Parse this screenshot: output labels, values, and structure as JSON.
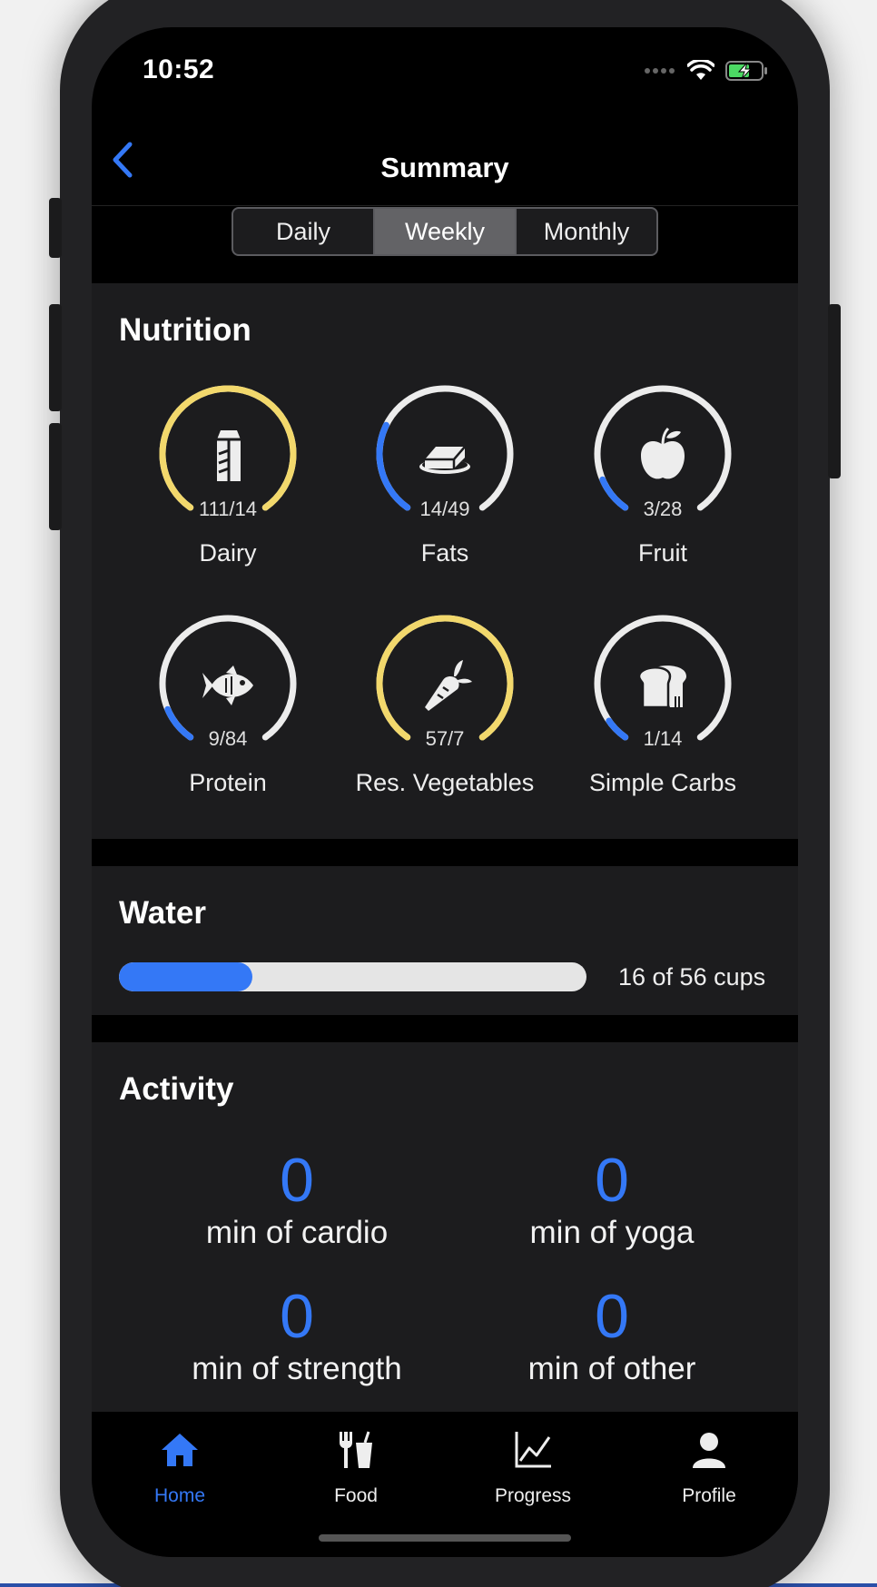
{
  "status_bar": {
    "time": "10:52"
  },
  "nav": {
    "title": "Summary"
  },
  "segments": [
    {
      "label": "Daily",
      "active": false
    },
    {
      "label": "Weekly",
      "active": true
    },
    {
      "label": "Monthly",
      "active": false
    }
  ],
  "nutrition": {
    "title": "Nutrition",
    "items": [
      {
        "label": "Dairy",
        "count": "111/14",
        "progress": 1.0,
        "color": "#f2d86c",
        "icon": "milk-carton-icon"
      },
      {
        "label": "Fats",
        "count": "14/49",
        "progress": 0.28,
        "color": "#3478f6",
        "icon": "butter-icon"
      },
      {
        "label": "Fruit",
        "count": "3/28",
        "progress": 0.11,
        "color": "#3478f6",
        "icon": "apple-icon"
      },
      {
        "label": "Protein",
        "count": "9/84",
        "progress": 0.11,
        "color": "#3478f6",
        "icon": "fish-icon"
      },
      {
        "label": "Res. Vegetables",
        "count": "57/7",
        "progress": 1.0,
        "color": "#f2d86c",
        "icon": "carrot-icon"
      },
      {
        "label": "Simple Carbs",
        "count": "1/14",
        "progress": 0.07,
        "color": "#3478f6",
        "icon": "bread-icon"
      }
    ]
  },
  "water": {
    "title": "Water",
    "text": "16 of 56 cups",
    "progress": 0.286
  },
  "activity": {
    "title": "Activity",
    "items": [
      {
        "value": "0",
        "label": "min of cardio"
      },
      {
        "value": "0",
        "label": "min of yoga"
      },
      {
        "value": "0",
        "label": "min of strength"
      },
      {
        "value": "0",
        "label": "min of other"
      }
    ]
  },
  "tabs": [
    {
      "label": "Home",
      "icon": "home-icon",
      "active": true
    },
    {
      "label": "Food",
      "icon": "utensils-drink-icon",
      "active": false
    },
    {
      "label": "Progress",
      "icon": "chart-line-icon",
      "active": false
    },
    {
      "label": "Profile",
      "icon": "person-icon",
      "active": false
    }
  ],
  "colors": {
    "accent": "#3478f6",
    "over_goal": "#f2d86c",
    "track": "#ececec",
    "card": "#1c1c1e"
  }
}
